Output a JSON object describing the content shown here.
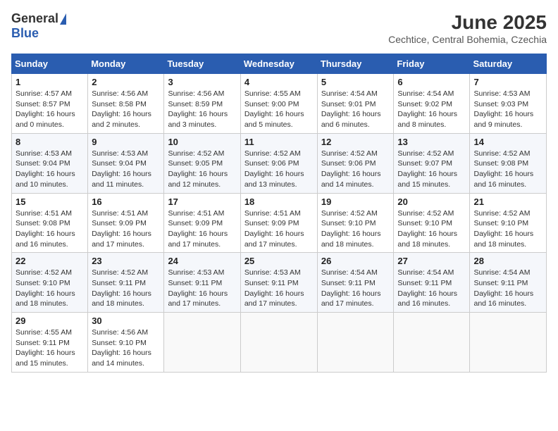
{
  "logo": {
    "general": "General",
    "blue": "Blue"
  },
  "header": {
    "month": "June 2025",
    "location": "Cechtice, Central Bohemia, Czechia"
  },
  "weekdays": [
    "Sunday",
    "Monday",
    "Tuesday",
    "Wednesday",
    "Thursday",
    "Friday",
    "Saturday"
  ],
  "weeks": [
    [
      {
        "day": "1",
        "info": "Sunrise: 4:57 AM\nSunset: 8:57 PM\nDaylight: 16 hours\nand 0 minutes."
      },
      {
        "day": "2",
        "info": "Sunrise: 4:56 AM\nSunset: 8:58 PM\nDaylight: 16 hours\nand 2 minutes."
      },
      {
        "day": "3",
        "info": "Sunrise: 4:56 AM\nSunset: 8:59 PM\nDaylight: 16 hours\nand 3 minutes."
      },
      {
        "day": "4",
        "info": "Sunrise: 4:55 AM\nSunset: 9:00 PM\nDaylight: 16 hours\nand 5 minutes."
      },
      {
        "day": "5",
        "info": "Sunrise: 4:54 AM\nSunset: 9:01 PM\nDaylight: 16 hours\nand 6 minutes."
      },
      {
        "day": "6",
        "info": "Sunrise: 4:54 AM\nSunset: 9:02 PM\nDaylight: 16 hours\nand 8 minutes."
      },
      {
        "day": "7",
        "info": "Sunrise: 4:53 AM\nSunset: 9:03 PM\nDaylight: 16 hours\nand 9 minutes."
      }
    ],
    [
      {
        "day": "8",
        "info": "Sunrise: 4:53 AM\nSunset: 9:04 PM\nDaylight: 16 hours\nand 10 minutes."
      },
      {
        "day": "9",
        "info": "Sunrise: 4:53 AM\nSunset: 9:04 PM\nDaylight: 16 hours\nand 11 minutes."
      },
      {
        "day": "10",
        "info": "Sunrise: 4:52 AM\nSunset: 9:05 PM\nDaylight: 16 hours\nand 12 minutes."
      },
      {
        "day": "11",
        "info": "Sunrise: 4:52 AM\nSunset: 9:06 PM\nDaylight: 16 hours\nand 13 minutes."
      },
      {
        "day": "12",
        "info": "Sunrise: 4:52 AM\nSunset: 9:06 PM\nDaylight: 16 hours\nand 14 minutes."
      },
      {
        "day": "13",
        "info": "Sunrise: 4:52 AM\nSunset: 9:07 PM\nDaylight: 16 hours\nand 15 minutes."
      },
      {
        "day": "14",
        "info": "Sunrise: 4:52 AM\nSunset: 9:08 PM\nDaylight: 16 hours\nand 16 minutes."
      }
    ],
    [
      {
        "day": "15",
        "info": "Sunrise: 4:51 AM\nSunset: 9:08 PM\nDaylight: 16 hours\nand 16 minutes."
      },
      {
        "day": "16",
        "info": "Sunrise: 4:51 AM\nSunset: 9:09 PM\nDaylight: 16 hours\nand 17 minutes."
      },
      {
        "day": "17",
        "info": "Sunrise: 4:51 AM\nSunset: 9:09 PM\nDaylight: 16 hours\nand 17 minutes."
      },
      {
        "day": "18",
        "info": "Sunrise: 4:51 AM\nSunset: 9:09 PM\nDaylight: 16 hours\nand 17 minutes."
      },
      {
        "day": "19",
        "info": "Sunrise: 4:52 AM\nSunset: 9:10 PM\nDaylight: 16 hours\nand 18 minutes."
      },
      {
        "day": "20",
        "info": "Sunrise: 4:52 AM\nSunset: 9:10 PM\nDaylight: 16 hours\nand 18 minutes."
      },
      {
        "day": "21",
        "info": "Sunrise: 4:52 AM\nSunset: 9:10 PM\nDaylight: 16 hours\nand 18 minutes."
      }
    ],
    [
      {
        "day": "22",
        "info": "Sunrise: 4:52 AM\nSunset: 9:10 PM\nDaylight: 16 hours\nand 18 minutes."
      },
      {
        "day": "23",
        "info": "Sunrise: 4:52 AM\nSunset: 9:11 PM\nDaylight: 16 hours\nand 18 minutes."
      },
      {
        "day": "24",
        "info": "Sunrise: 4:53 AM\nSunset: 9:11 PM\nDaylight: 16 hours\nand 17 minutes."
      },
      {
        "day": "25",
        "info": "Sunrise: 4:53 AM\nSunset: 9:11 PM\nDaylight: 16 hours\nand 17 minutes."
      },
      {
        "day": "26",
        "info": "Sunrise: 4:54 AM\nSunset: 9:11 PM\nDaylight: 16 hours\nand 17 minutes."
      },
      {
        "day": "27",
        "info": "Sunrise: 4:54 AM\nSunset: 9:11 PM\nDaylight: 16 hours\nand 16 minutes."
      },
      {
        "day": "28",
        "info": "Sunrise: 4:54 AM\nSunset: 9:11 PM\nDaylight: 16 hours\nand 16 minutes."
      }
    ],
    [
      {
        "day": "29",
        "info": "Sunrise: 4:55 AM\nSunset: 9:11 PM\nDaylight: 16 hours\nand 15 minutes."
      },
      {
        "day": "30",
        "info": "Sunrise: 4:56 AM\nSunset: 9:10 PM\nDaylight: 16 hours\nand 14 minutes."
      },
      null,
      null,
      null,
      null,
      null
    ]
  ]
}
